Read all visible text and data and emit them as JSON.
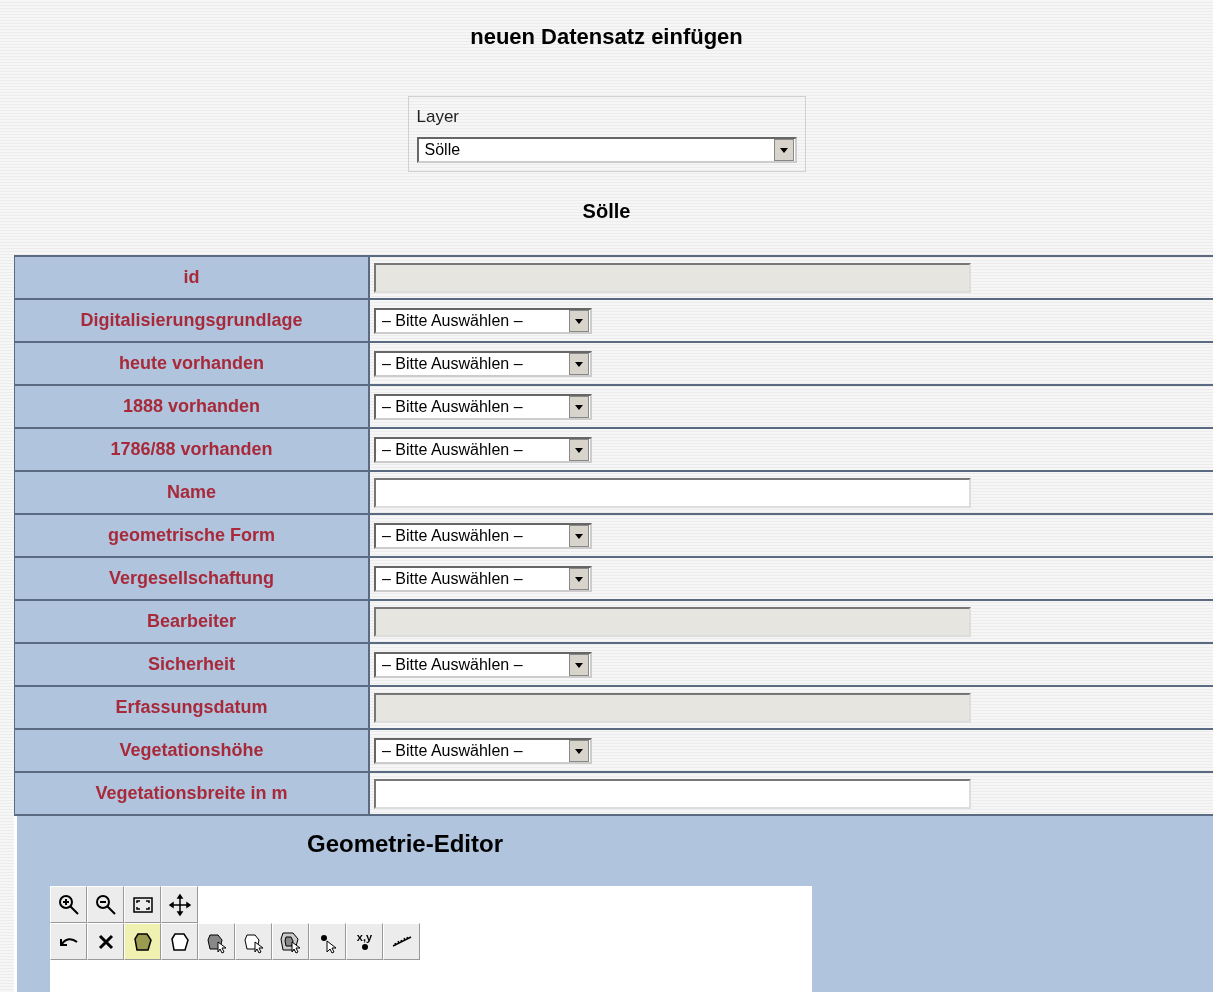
{
  "title": "neuen Datensatz einfügen",
  "layer": {
    "label": "Layer",
    "value": "Sölle"
  },
  "section_title": "Sölle",
  "fields": [
    {
      "label": "id",
      "kind": "readonly"
    },
    {
      "label": "Digitalisierungsgrundlage",
      "kind": "select",
      "value": "– Bitte Auswählen –"
    },
    {
      "label": "heute vorhanden",
      "kind": "select",
      "value": "– Bitte Auswählen –"
    },
    {
      "label": "1888 vorhanden",
      "kind": "select",
      "value": "– Bitte Auswählen –"
    },
    {
      "label": "1786/88 vorhanden",
      "kind": "select",
      "value": "– Bitte Auswählen –"
    },
    {
      "label": "Name",
      "kind": "text"
    },
    {
      "label": "geometrische Form",
      "kind": "select",
      "value": "– Bitte Auswählen –"
    },
    {
      "label": "Vergesellschaftung",
      "kind": "select",
      "value": "– Bitte Auswählen –"
    },
    {
      "label": "Bearbeiter",
      "kind": "readonly"
    },
    {
      "label": "Sicherheit",
      "kind": "select",
      "value": "– Bitte Auswählen –"
    },
    {
      "label": "Erfassungsdatum",
      "kind": "readonly"
    },
    {
      "label": "Vegetationshöhe",
      "kind": "select",
      "value": "– Bitte Auswählen –"
    },
    {
      "label": "Vegetationsbreite in m",
      "kind": "text"
    }
  ],
  "editor": {
    "title": "Geometrie-Editor",
    "toolbar_rows": [
      [
        {
          "kind": "zoom-in",
          "selected": false
        },
        {
          "kind": "zoom-out",
          "selected": false
        },
        {
          "kind": "full-extent",
          "selected": false
        },
        {
          "kind": "pan",
          "selected": false
        }
      ],
      [
        {
          "kind": "undo",
          "selected": false
        },
        {
          "kind": "delete",
          "selected": false
        },
        {
          "kind": "polygon-filled",
          "selected": true
        },
        {
          "kind": "polygon",
          "selected": false
        },
        {
          "kind": "select-filled",
          "selected": false
        },
        {
          "kind": "select-outline",
          "selected": false
        },
        {
          "kind": "select-ring",
          "selected": false
        },
        {
          "kind": "point-cursor",
          "selected": false
        },
        {
          "kind": "coordinate",
          "selected": false,
          "label": "x,y"
        },
        {
          "kind": "measure",
          "selected": false
        }
      ]
    ]
  }
}
